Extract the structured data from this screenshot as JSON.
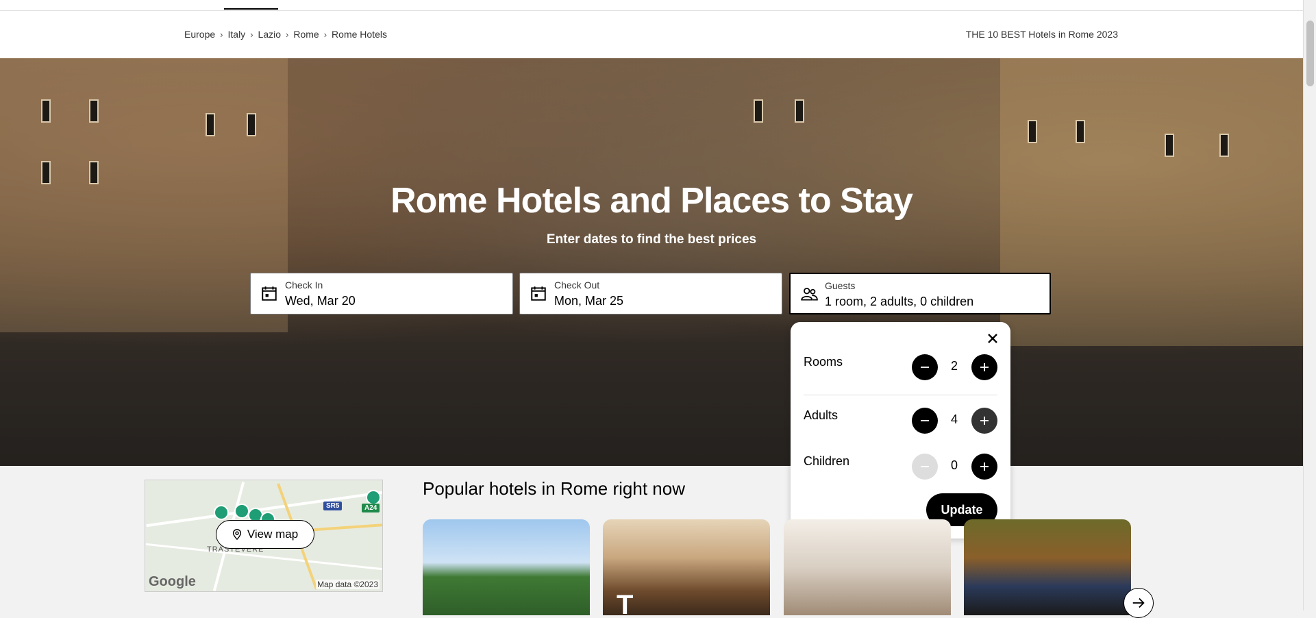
{
  "breadcrumb": {
    "items": [
      "Europe",
      "Italy",
      "Lazio",
      "Rome",
      "Rome Hotels"
    ],
    "separator": "›",
    "right_text": "THE 10 BEST Hotels in Rome 2023"
  },
  "hero": {
    "title": "Rome Hotels and Places to Stay",
    "subtitle": "Enter dates to find the best prices",
    "check_in": {
      "label": "Check In",
      "value": "Wed, Mar 20",
      "icon": "calendar-icon"
    },
    "check_out": {
      "label": "Check Out",
      "value": "Mon, Mar 25",
      "icon": "calendar-icon"
    },
    "guests": {
      "label": "Guests",
      "value": "1 room, 2 adults, 0 children",
      "icon": "people-icon"
    }
  },
  "guests_popup": {
    "rows": [
      {
        "label": "Rooms",
        "count": "2"
      },
      {
        "label": "Adults",
        "count": "4"
      },
      {
        "label": "Children",
        "count": "0"
      }
    ],
    "update_label": "Update"
  },
  "map": {
    "button_label": "View map",
    "district": "TRASTEVERE",
    "road_tags": [
      "SR5",
      "A24"
    ],
    "logo": "Google",
    "attribution": "Map data ©2023"
  },
  "popular": {
    "title": "Popular hotels in Rome right now",
    "card2_text": "T"
  },
  "colors": {
    "accent": "#000000",
    "map_pin": "#1f9d74"
  }
}
